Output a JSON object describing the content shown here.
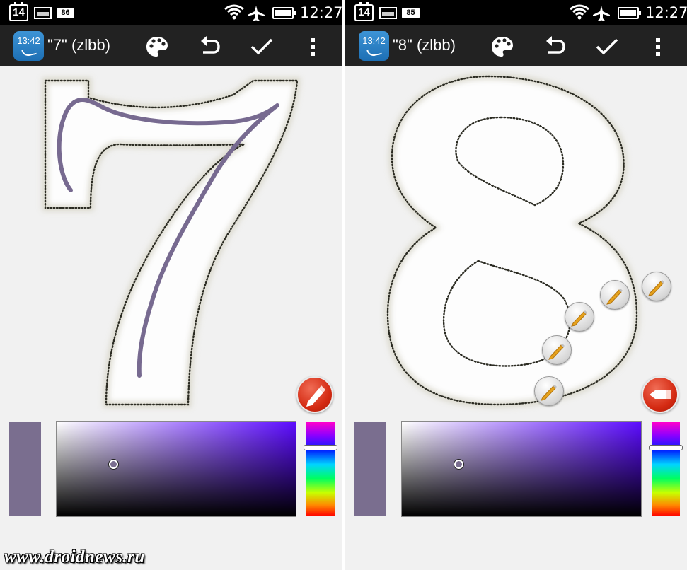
{
  "colors": {
    "status_bar": "#000000",
    "action_bar": "#222222",
    "canvas": "#f1f1f1",
    "stroke": "#776a90",
    "selected_color": "#7a6e8f",
    "picker_hue": "#5c0cff",
    "fab": "#d42a12"
  },
  "panels": [
    {
      "status": {
        "calendar_day": "14",
        "battery_level": "86",
        "time": "12:27"
      },
      "app_icon_time": "13:42",
      "title": "\"7\" (zlbb)",
      "digit": "7",
      "icons": [
        "palette-icon",
        "undo-icon",
        "check-icon",
        "overflow-menu-icon",
        "pen-fab-icon"
      ]
    },
    {
      "status": {
        "calendar_day": "14",
        "battery_level": "85",
        "time": "12:27"
      },
      "app_icon_time": "13:42",
      "title": "\"8\" (zlbb)",
      "digit": "8",
      "icons": [
        "palette-icon",
        "undo-icon",
        "check-icon",
        "overflow-menu-icon",
        "eraser-fab-icon",
        "pencil-marker-icon"
      ]
    }
  ],
  "watermark": "www.droidnews.ru"
}
